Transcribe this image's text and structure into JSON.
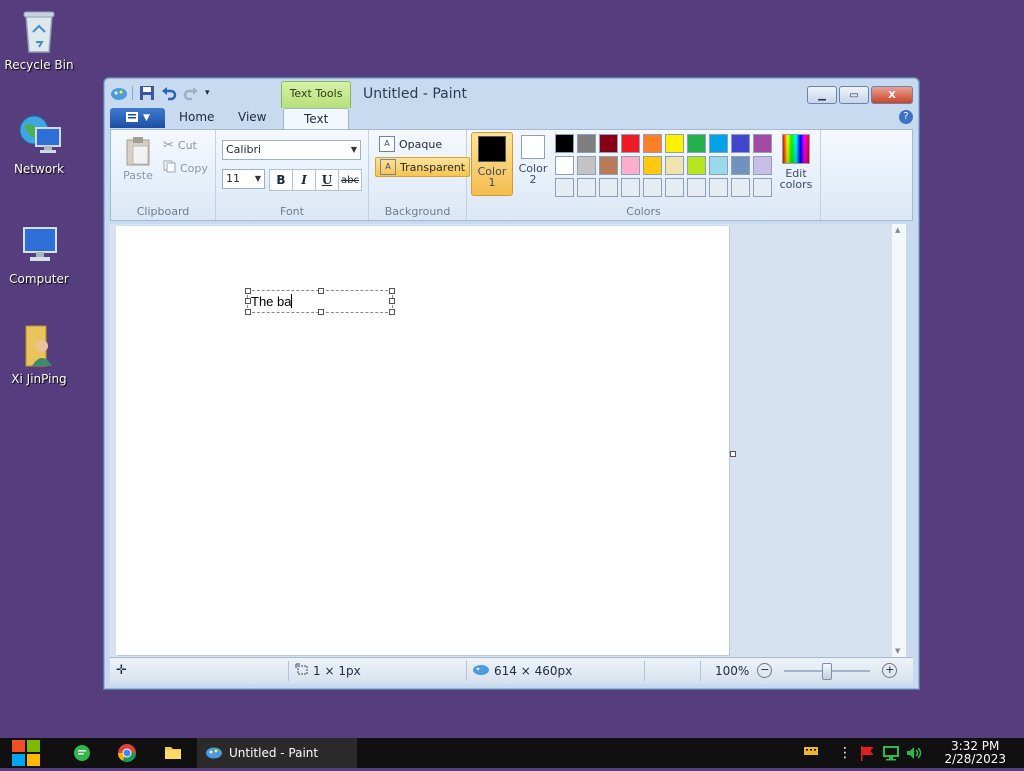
{
  "desktop": {
    "icons": [
      {
        "label": "Recycle Bin"
      },
      {
        "label": "Network"
      },
      {
        "label": "Computer"
      },
      {
        "label": "Xi JinPing"
      }
    ]
  },
  "window": {
    "title": "Untitled - Paint",
    "contextual_tab": "Text Tools",
    "close_glyph": "X",
    "tabs": {
      "home": "Home",
      "view": "View",
      "text": "Text"
    },
    "help_glyph": "?"
  },
  "ribbon": {
    "clipboard": {
      "title": "Clipboard",
      "paste": "Paste",
      "cut": "Cut",
      "copy": "Copy"
    },
    "font": {
      "title": "Font",
      "family": "Calibri",
      "size": "11",
      "bold": "B",
      "italic": "I",
      "underline": "U",
      "strike": "abc"
    },
    "background": {
      "title": "Background",
      "opaque": "Opaque",
      "transparent": "Transparent",
      "selected": "transparent"
    },
    "colors": {
      "title": "Colors",
      "color1_label": "Color",
      "color1_num": "1",
      "color2_label": "Color",
      "color2_num": "2",
      "color1": "#000000",
      "color2": "#ffffff",
      "edit_label_1": "Edit",
      "edit_label_2": "colors",
      "palette": [
        "#000000",
        "#7f7f7f",
        "#880015",
        "#ed1c24",
        "#ff7f27",
        "#fff200",
        "#22b14c",
        "#00a2e8",
        "#3f48cc",
        "#a349a4",
        "#ffffff",
        "#c3c3c3",
        "#b97a57",
        "#ffaec9",
        "#ffc90e",
        "#efe4b0",
        "#b5e61d",
        "#99d9ea",
        "#7092be",
        "#c8bfe7",
        "#e6ecf3",
        "#e6ecf3",
        "#e6ecf3",
        "#e6ecf3",
        "#e6ecf3",
        "#e6ecf3",
        "#e6ecf3",
        "#e6ecf3",
        "#e6ecf3",
        "#e6ecf3"
      ]
    }
  },
  "canvas": {
    "typed_text": "The ba"
  },
  "status": {
    "selection_size": "1 × 1px",
    "image_size": "614 × 460px",
    "zoom": "100%",
    "zoom_out": "−",
    "zoom_in": "+"
  },
  "taskbar": {
    "task_label": "Untitled - Paint",
    "time": "3:32 PM",
    "date": "2/28/2023"
  }
}
